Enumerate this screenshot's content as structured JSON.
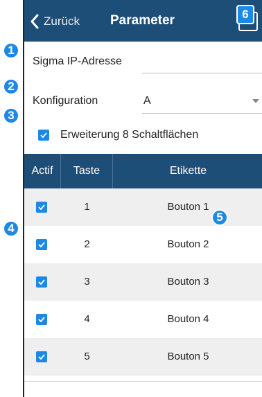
{
  "navbar": {
    "back_label": "Zurück",
    "title": "Parameter"
  },
  "form": {
    "ip_label": "Sigma IP-Adresse",
    "ip_value": "",
    "config_label": "Konfiguration",
    "config_value": "A",
    "extension_label": "Erweiterung 8 Schaltflächen",
    "extension_checked": true
  },
  "table": {
    "headers": [
      "Actif",
      "Taste",
      "Etikette"
    ],
    "rows": [
      {
        "active": true,
        "key": "1",
        "label": "Bouton 1"
      },
      {
        "active": true,
        "key": "2",
        "label": "Bouton 2"
      },
      {
        "active": true,
        "key": "3",
        "label": "Bouton 3"
      },
      {
        "active": true,
        "key": "4",
        "label": "Bouton 4"
      },
      {
        "active": true,
        "key": "5",
        "label": "Bouton 5"
      }
    ]
  },
  "callouts": [
    "1",
    "2",
    "3",
    "4",
    "5",
    "6"
  ],
  "colors": {
    "navbar": "#1d4e78",
    "accent": "#1e88e5",
    "row_alt": "#efefef"
  }
}
